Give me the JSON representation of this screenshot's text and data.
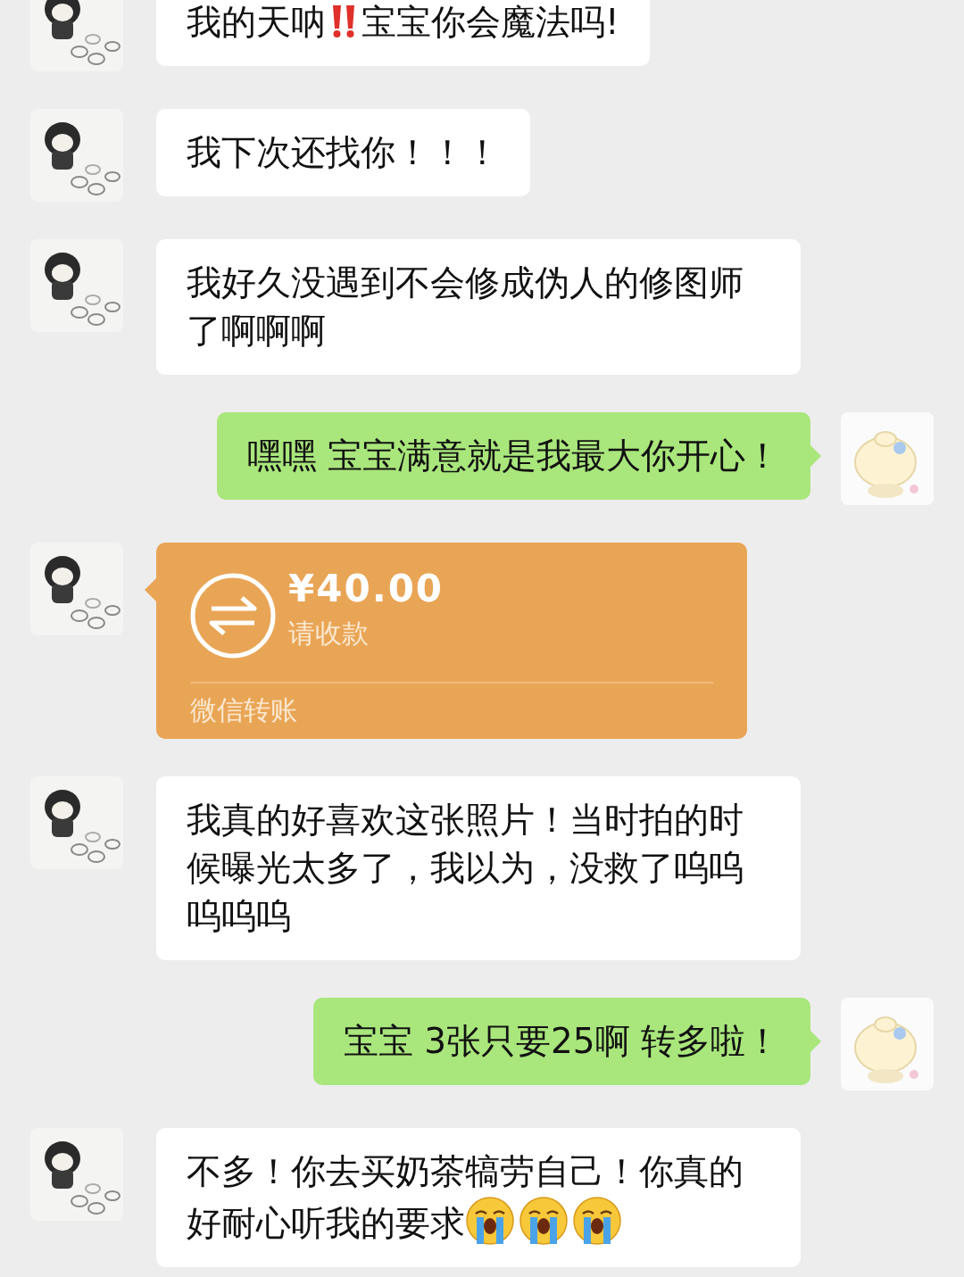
{
  "messages": [
    {
      "outgoing": false,
      "kind": "text",
      "parts": [
        {
          "kind": "text",
          "text": "我的天呐"
        },
        {
          "kind": "double-exclamation"
        },
        {
          "kind": "text",
          "text": "宝宝你会魔法吗!"
        }
      ]
    },
    {
      "outgoing": false,
      "kind": "text",
      "parts": [
        {
          "kind": "text",
          "text": "我下次还找你！！！"
        }
      ]
    },
    {
      "outgoing": false,
      "kind": "text",
      "parts": [
        {
          "kind": "text",
          "text": "我好久没遇到不会修成伪人的修图师了啊啊啊"
        }
      ]
    },
    {
      "outgoing": true,
      "kind": "text",
      "parts": [
        {
          "kind": "text",
          "text": "嘿嘿 宝宝满意就是我最大你开心！"
        }
      ]
    },
    {
      "outgoing": false,
      "kind": "transfer",
      "amount": "¥40.00",
      "note": "请收款",
      "footer": "微信转账"
    },
    {
      "outgoing": false,
      "kind": "text",
      "parts": [
        {
          "kind": "text",
          "text": "我真的好喜欢这张照片！当时拍的时候曝光太多了，我以为，没救了呜呜呜呜呜"
        }
      ]
    },
    {
      "outgoing": true,
      "kind": "text",
      "parts": [
        {
          "kind": "text",
          "text": "宝宝 3张只要25啊 转多啦！"
        }
      ]
    },
    {
      "outgoing": false,
      "kind": "text",
      "parts": [
        {
          "kind": "text",
          "text": "不多！你去买奶茶犒劳自己！你真的好耐心听我的要求"
        },
        {
          "kind": "crying-face"
        },
        {
          "kind": "crying-face"
        },
        {
          "kind": "crying-face"
        }
      ]
    }
  ]
}
